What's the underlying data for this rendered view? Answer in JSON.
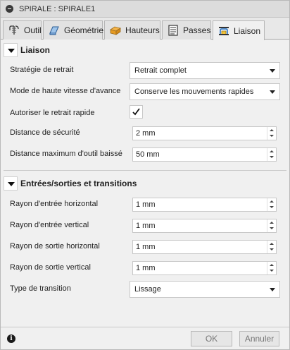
{
  "window": {
    "title": "SPIRALE : SPIRALE1"
  },
  "tabs": [
    {
      "label": "Outil",
      "icon": "tool-icon"
    },
    {
      "label": "Géométrie",
      "icon": "geometry-icon"
    },
    {
      "label": "Hauteurs",
      "icon": "heights-icon"
    },
    {
      "label": "Passes",
      "icon": "passes-icon"
    },
    {
      "label": "Liaison",
      "icon": "linking-icon",
      "active": true
    }
  ],
  "liaison": {
    "title": "Liaison",
    "retract_strategy": {
      "label": "Stratégie de retrait",
      "value": "Retrait complet"
    },
    "high_feed_mode": {
      "label": "Mode de haute vitesse d'avance",
      "value": "Conserve les mouvements rapides"
    },
    "allow_rapid_retract": {
      "label": "Autoriser le retrait rapide",
      "checked": true
    },
    "safe_distance": {
      "label": "Distance de sécurité",
      "value": "2 mm"
    },
    "max_stay_down": {
      "label": "Distance maximum d'outil baissé",
      "value": "50 mm"
    }
  },
  "leads": {
    "title": "Entrées/sorties et transitions",
    "horizontal_lead_in": {
      "label": "Rayon d'entrée horizontal",
      "value": "1 mm"
    },
    "vertical_lead_in": {
      "label": "Rayon d'entrée vertical",
      "value": "1 mm"
    },
    "horizontal_lead_out": {
      "label": "Rayon de sortie horizontal",
      "value": "1 mm"
    },
    "vertical_lead_out": {
      "label": "Rayon de sortie vertical",
      "value": "1 mm"
    },
    "transition_type": {
      "label": "Type de transition",
      "value": "Lissage"
    }
  },
  "footer": {
    "ok_label": "OK",
    "cancel_label": "Annuler",
    "info_glyph": "i"
  },
  "colors": {
    "accent": "#1f6fc5",
    "tab_active_bg": "#f0f0f0",
    "disabled_text": "#777777"
  }
}
